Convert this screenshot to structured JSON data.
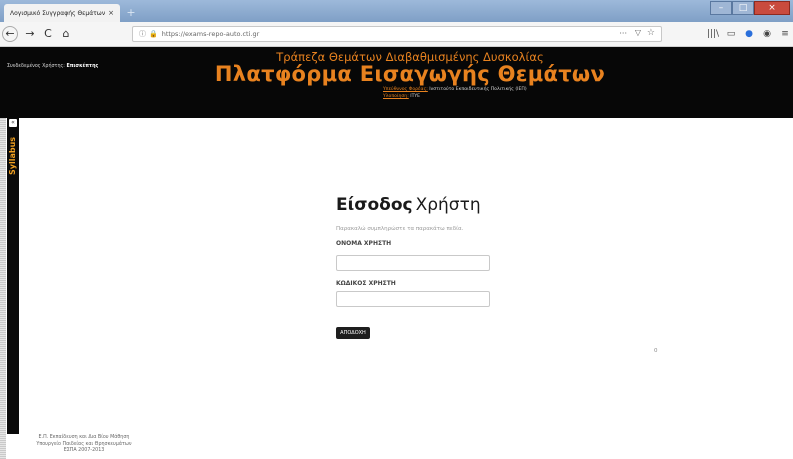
{
  "browser": {
    "tab_title": "Λογισμικό Συγγραφής Θεμάτων",
    "tab_close": "×",
    "new_tab": "+",
    "url": "https://exams-repo-auto.cti.gr",
    "window_controls": {
      "minimize": "–",
      "maximize": "□",
      "close": "×"
    },
    "nav": {
      "back": "←",
      "forward": "→",
      "reload": "C",
      "home": "⌂"
    },
    "url_icons": {
      "info": "ⓘ",
      "insecure": "🔒",
      "more": "···",
      "pocket": "▽",
      "star": "☆"
    },
    "toolbar_icons": [
      "|||\\",
      "▭",
      "●",
      "◉",
      "≡"
    ]
  },
  "header": {
    "user_label": "Συνδεδεμένος Χρήστης:",
    "user_name": "Επισκέπτης",
    "title_line1": "Τράπεζα Θεμάτων Διαβαθμισμένης Δυσκολίας",
    "title_line2": "Πλατφόρμα Εισαγωγής Θεμάτων",
    "responsible_label": "Υπεύθυνος Φορέας:",
    "responsible_value": "Ινστιτούτο Εκπαιδευτικής Πολιτικής (ΙΕΠ)",
    "implementation_label": "Υλοποίηση:",
    "implementation_value": "ΙΤΥΕ"
  },
  "sidebar": {
    "label": "Syllabus",
    "toggle": "«"
  },
  "login": {
    "title_bold": "Είσοδος",
    "title_light": "Χρήστη",
    "hint": "Παρακαλώ συμπληρώστε τα παρακάτω πεδία.",
    "username_label": "ΟΝΟΜΑ ΧΡΗΣΤΗ",
    "username_value": "",
    "password_label": "ΚΩΔΙΚΟΣ ΧΡΗΣΤΗ",
    "password_value": "",
    "submit_label": "ΑΠΟΔΟΧΗ"
  },
  "counter": "0",
  "footer": {
    "line1": "Ε.Π. Εκπαίδευση και Δια Βίου Μάθηση",
    "line2": "Υπουργείο Παιδείας και Θρησκευμάτων",
    "line3": "ΕΣΠΑ 2007-2013"
  }
}
